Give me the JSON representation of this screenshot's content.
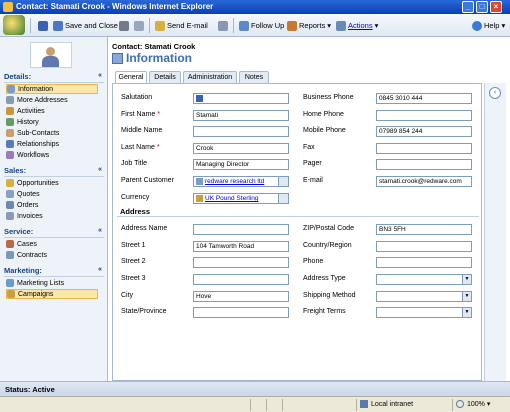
{
  "window": {
    "title": "Contact: Stamati Crook - Windows Internet Explorer"
  },
  "toolbar": {
    "save_close": "Save and Close",
    "send_email": "Send E-mail",
    "follow_up": "Follow Up",
    "reports": "Reports",
    "actions": "Actions",
    "help": "Help"
  },
  "header": {
    "contact_title": "Contact: Stamati Crook",
    "section_title": "Information"
  },
  "nav": {
    "details_title": "Details:",
    "details": [
      "Information",
      "More Addresses",
      "Activities",
      "History",
      "Sub-Contacts",
      "Relationships",
      "Workflows"
    ],
    "sales_title": "Sales:",
    "sales": [
      "Opportunities",
      "Quotes",
      "Orders",
      "Invoices"
    ],
    "service_title": "Service:",
    "service": [
      "Cases",
      "Contracts"
    ],
    "marketing_title": "Marketing:",
    "marketing": [
      "Marketing Lists",
      "Campaigns"
    ]
  },
  "tabs": [
    "General",
    "Details",
    "Administration",
    "Notes"
  ],
  "form": {
    "salutation_label": "Salutation",
    "first_name_label": "First Name",
    "first_name": "Stamati",
    "middle_name_label": "Middle Name",
    "last_name_label": "Last Name",
    "last_name": "Crook",
    "job_title_label": "Job Title",
    "job_title": "Managing Director",
    "parent_customer_label": "Parent Customer",
    "parent_customer": "redware research ltd",
    "currency_label": "Currency",
    "currency": "UK Pound Sterling",
    "business_phone_label": "Business Phone",
    "business_phone": "0845 3010 444",
    "home_phone_label": "Home Phone",
    "mobile_phone_label": "Mobile Phone",
    "mobile_phone": "07989 854 244",
    "fax_label": "Fax",
    "pager_label": "Pager",
    "email_label": "E-mail",
    "email": "stamati.crook@redware.com",
    "address_section": "Address",
    "address_name_label": "Address Name",
    "street1_label": "Street 1",
    "street1": "104 Tamworth Road",
    "street2_label": "Street 2",
    "street3_label": "Street 3",
    "city_label": "City",
    "city": "Hove",
    "state_label": "State/Province",
    "zip_label": "ZIP/Postal Code",
    "zip": "BN3 5FH",
    "country_label": "Country/Region",
    "phone_label": "Phone",
    "address_type_label": "Address Type",
    "shipping_method_label": "Shipping Method",
    "freight_terms_label": "Freight Terms"
  },
  "status": {
    "text": "Status: Active"
  },
  "ie_status": {
    "zone": "Local intranet",
    "zoom": "100%"
  }
}
